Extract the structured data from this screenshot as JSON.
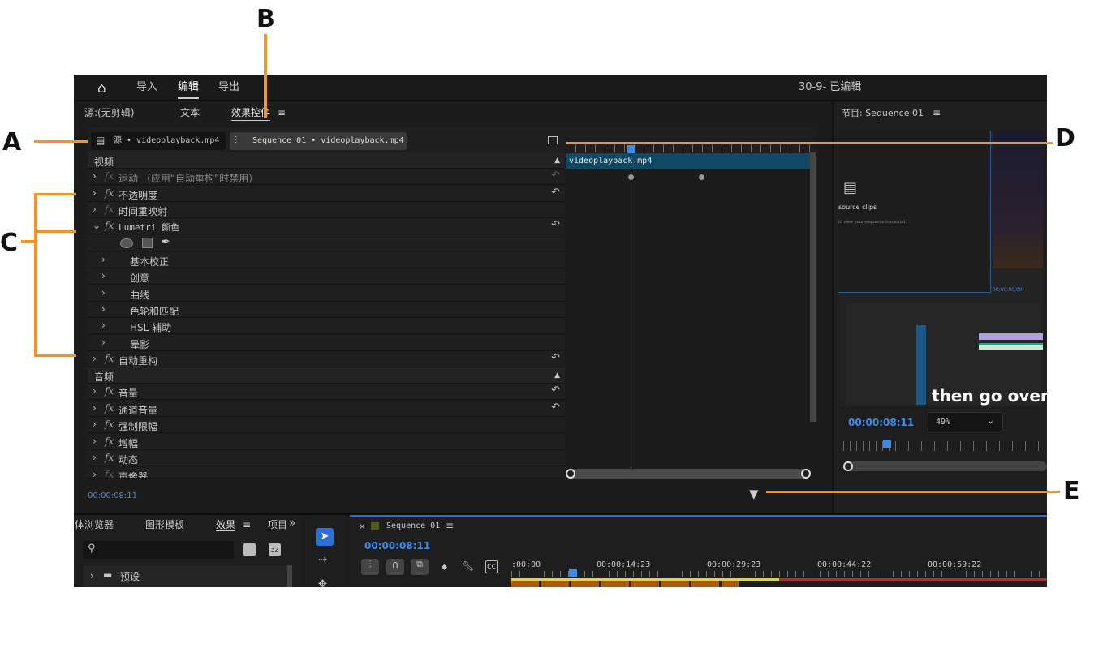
{
  "annotations": {
    "a": "A",
    "b": "B",
    "c": "C",
    "d": "D",
    "e": "E"
  },
  "topbar": {
    "tabs": [
      "导入",
      "编辑",
      "导出"
    ],
    "title": "30-9- 已编辑"
  },
  "source_panel": {
    "tabs": [
      "源:(无剪辑)",
      "文本",
      "效果控件"
    ],
    "menu": "≡"
  },
  "effect_controls": {
    "source_tab": "源 • videoplayback.mp4",
    "sequence_tab": "Sequence 01 • videoplayback.mp4",
    "video_header": "视频",
    "rows": [
      {
        "label": "运动  （应用“自动重构”时禁用）",
        "reset": true
      },
      {
        "label": "不透明度",
        "reset": true
      },
      {
        "label": "时间重映射",
        "reset": false
      },
      {
        "label": "Lumetri 颜色",
        "reset": true
      }
    ],
    "lumetri_sub": [
      "基本校正",
      "创意",
      "曲线",
      "色轮和匹配",
      "HSL 辅助",
      "晕影"
    ],
    "autoreframe": "自动重构",
    "audio_header": "音频",
    "audio_rows": [
      "音量",
      "通道音量",
      "强制限幅",
      "增幅",
      "动态",
      "声像器"
    ],
    "clip_name": "videoplayback.mp4",
    "timecode": "00:00:08:11"
  },
  "program": {
    "title": "节目: Sequence 01",
    "menu": "≡",
    "inner_heading": "source clips",
    "inner_sub": "to view your sequence transcript.",
    "caption": "then go over a",
    "inner_tc": "00;00;00;00",
    "timecode": "00:00:08:11",
    "zoom": "49%"
  },
  "effects_panel": {
    "tabs": [
      "体浏览器",
      "图形模板",
      "效果",
      "项目"
    ],
    "more": "»",
    "preset": "预设",
    "btn1": "32"
  },
  "timeline": {
    "title": "Sequence 01",
    "timecode": "00:00:08:11",
    "ticks": [
      ":00:00",
      "00:00:14:23",
      "00:00:29:23",
      "00:00:44:22",
      "00:00:59:22"
    ]
  },
  "colors": {
    "accent": "#2d8ceb",
    "annotation": "#f0952a",
    "clip": "#0e4a66"
  }
}
